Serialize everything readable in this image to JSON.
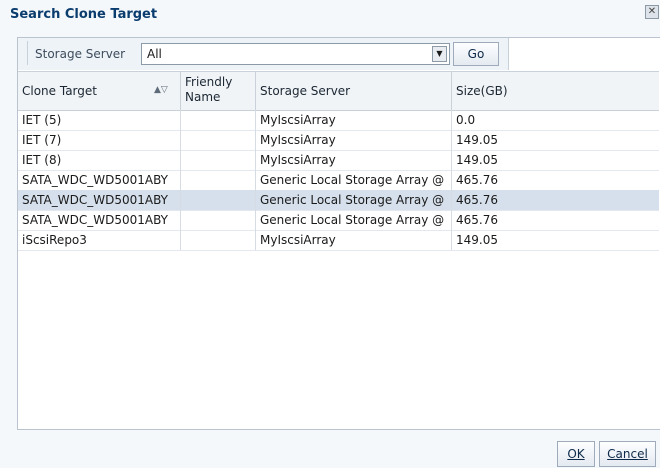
{
  "dialog": {
    "title": "Search Clone Target",
    "close_glyph": "✕"
  },
  "filter": {
    "label": "Storage Server",
    "selected": "All",
    "go_label": "Go"
  },
  "table": {
    "columns": [
      "Clone Target",
      "Friendly Name",
      "Storage Server",
      "Size(GB)"
    ],
    "sort_glyph": "▲▽",
    "rows": [
      {
        "target": "IET (5)",
        "friendly": "",
        "server": "MyIscsiArray",
        "size": "0.0"
      },
      {
        "target": "IET (7)",
        "friendly": "",
        "server": "MyIscsiArray",
        "size": "149.05"
      },
      {
        "target": "IET (8)",
        "friendly": "",
        "server": "MyIscsiArray",
        "size": "149.05"
      },
      {
        "target": "SATA_WDC_WD5001ABY",
        "friendly": "",
        "server": "Generic Local Storage Array @",
        "size": "465.76"
      },
      {
        "target": "SATA_WDC_WD5001ABY",
        "friendly": "",
        "server": "Generic Local Storage Array @",
        "size": "465.76"
      },
      {
        "target": "SATA_WDC_WD5001ABY",
        "friendly": "",
        "server": "Generic Local Storage Array @",
        "size": "465.76"
      },
      {
        "target": "iScsiRepo3",
        "friendly": "",
        "server": "MyIscsiArray",
        "size": "149.05"
      }
    ],
    "selected_row": 4
  },
  "buttons": {
    "ok": "OK",
    "cancel": "Cancel"
  }
}
